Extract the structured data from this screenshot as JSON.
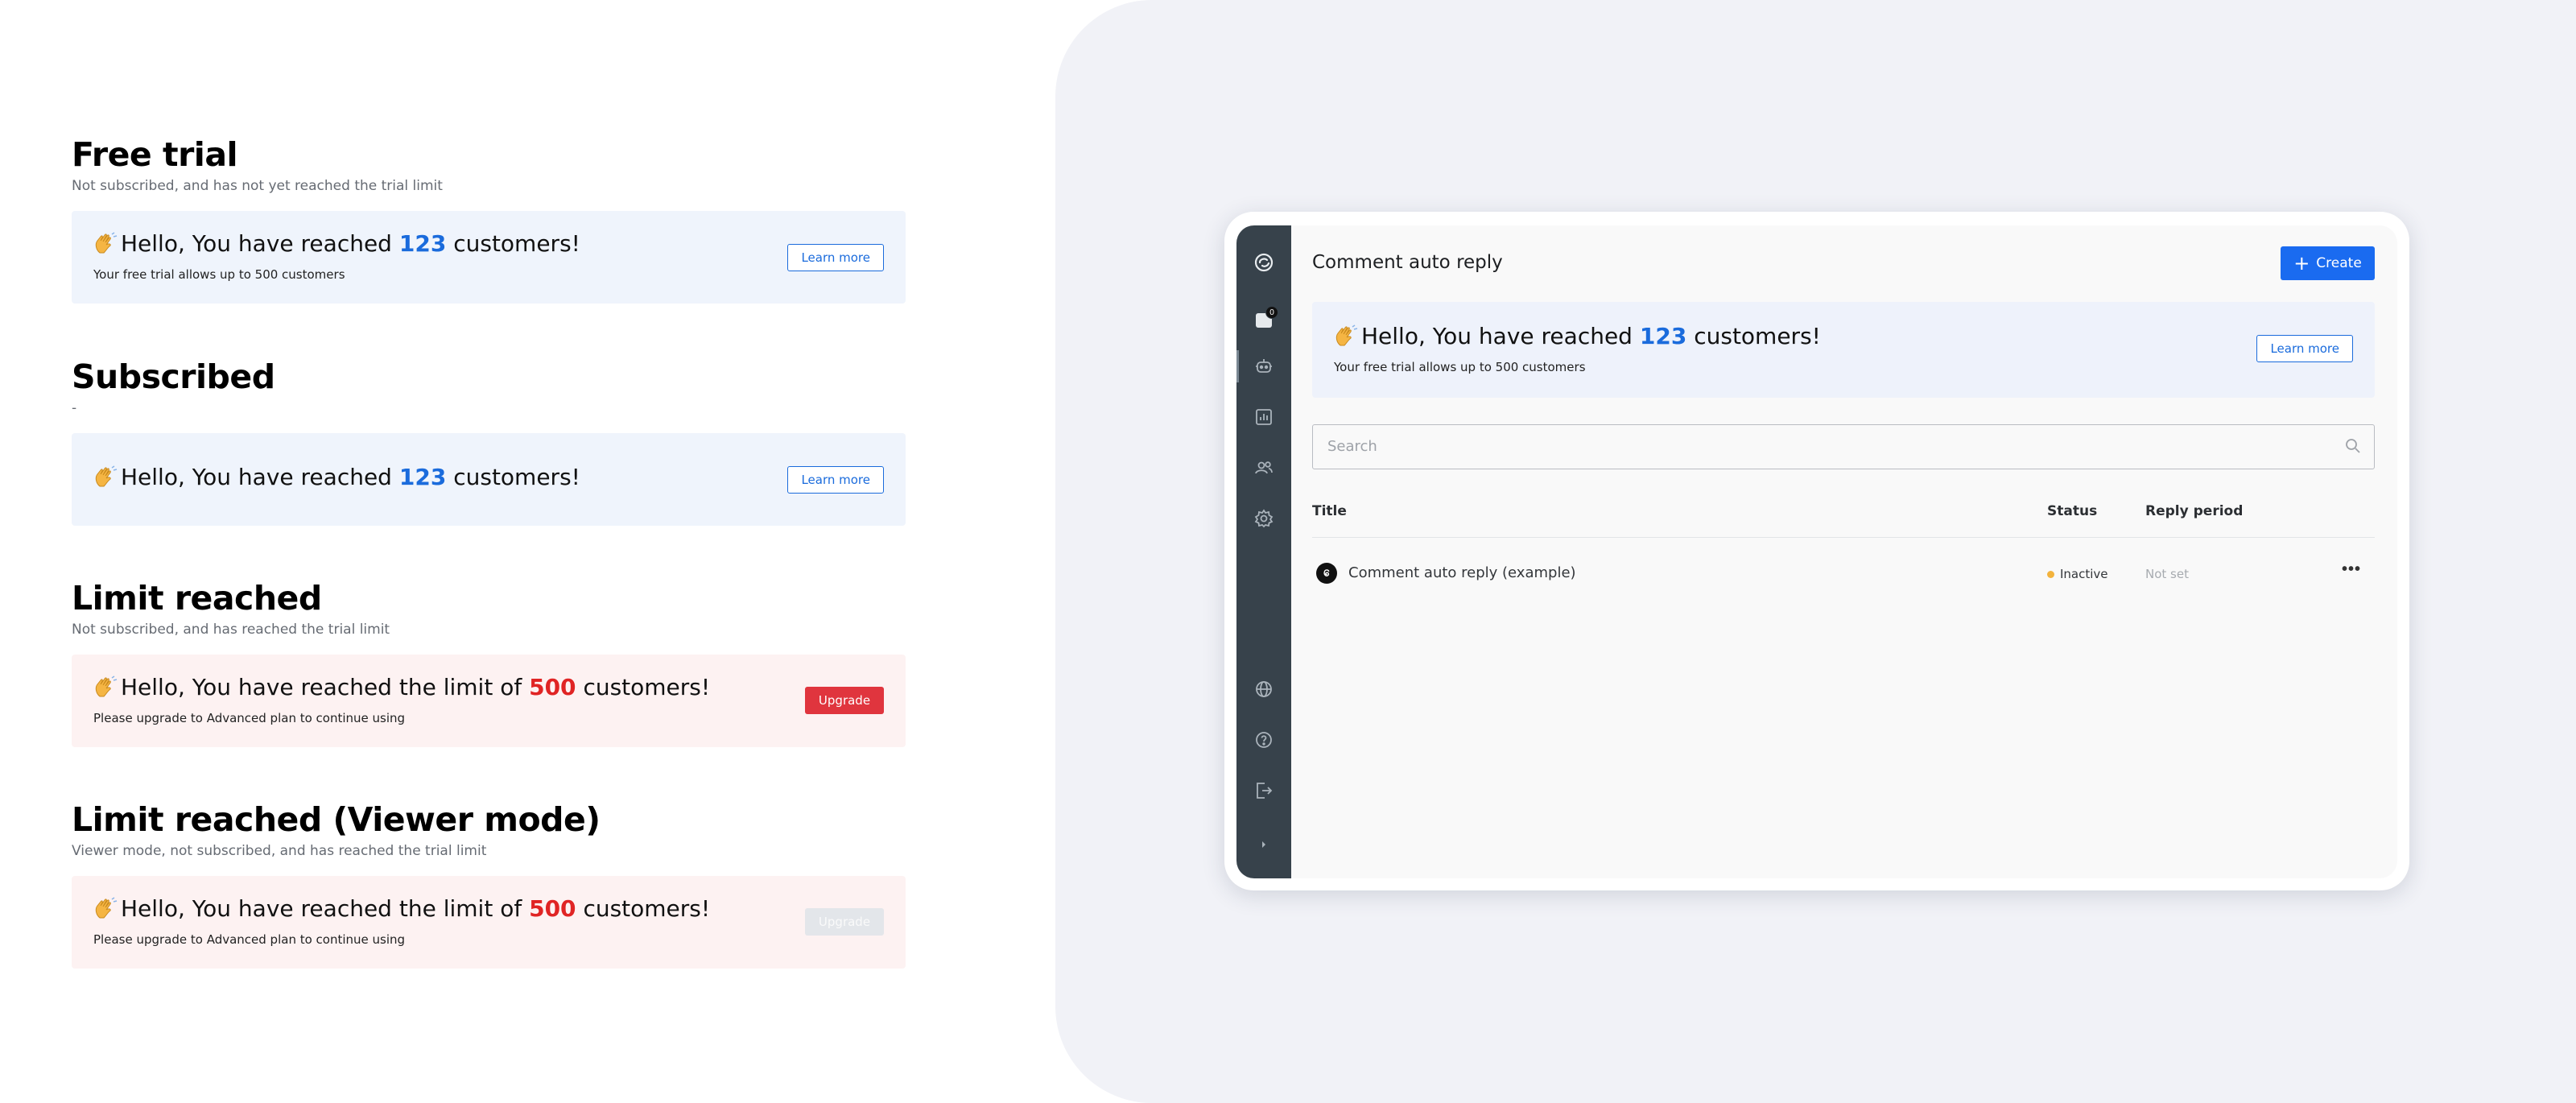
{
  "variants": [
    {
      "heading": "Free trial",
      "subtitle": "Not subscribed, and has not yet reached the trial limit",
      "headline_pre": "Hello, You have reached ",
      "headline_num": "123",
      "headline_post": " customers!",
      "caption": "Your free trial allows up to 500 customers",
      "button": "Learn more"
    },
    {
      "heading": "Subscribed",
      "subtitle": "-",
      "headline_pre": "Hello, You have reached ",
      "headline_num": "123",
      "headline_post": " customers!",
      "caption": "",
      "button": "Learn more"
    },
    {
      "heading": "Limit reached",
      "subtitle": "Not subscribed, and has reached the trial limit",
      "headline_pre": "Hello, You have reached the limit of ",
      "headline_num": "500",
      "headline_post": " customers!",
      "caption": "Please upgrade to Advanced plan to continue using",
      "button": "Upgrade"
    },
    {
      "heading": "Limit reached (Viewer mode)",
      "subtitle": "Viewer mode, not subscribed, and has reached the trial limit",
      "headline_pre": "Hello, You have reached the limit of ",
      "headline_num": "500",
      "headline_post": " customers!",
      "caption": "Please upgrade to Advanced plan to continue using",
      "button": "Upgrade"
    }
  ],
  "app": {
    "sidebar": {
      "badge_count": "0",
      "icons": [
        "logo-icon",
        "inbox-icon",
        "bot-icon",
        "analytics-icon",
        "contacts-icon",
        "settings-icon",
        "globe-icon",
        "help-icon",
        "logout-icon",
        "expand-icon"
      ]
    },
    "page_title": "Comment auto reply",
    "create_label": "Create",
    "banner": {
      "headline_pre": "Hello, You have reached ",
      "headline_num": "123",
      "headline_post": " customers!",
      "caption": "Your free trial allows up to 500 customers",
      "button": "Learn more"
    },
    "search": {
      "placeholder": "Search",
      "value": ""
    },
    "table": {
      "columns": {
        "title": "Title",
        "status": "Status",
        "reply_period": "Reply period"
      },
      "rows": [
        {
          "title": "Comment auto reply (example)",
          "status": "Inactive",
          "reply_period": "Not set"
        }
      ]
    }
  },
  "colors": {
    "accent_blue": "#1a6bdc",
    "danger_red": "#e0353e",
    "status_inactive": "#f3b33d",
    "sidebar_bg": "#37424b"
  }
}
